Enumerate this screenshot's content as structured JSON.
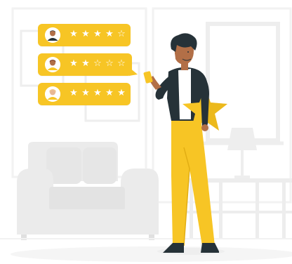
{
  "colors": {
    "accent": "#F7C525",
    "accent_dark": "#E2AE13",
    "background_shapes": "#F2F2F2",
    "background_lines": "#EDEDED",
    "furniture": "#EBEBEB",
    "furniture_shadow": "#E0E0E0",
    "skin": "#B26F47",
    "hair": "#263238",
    "jacket": "#263238",
    "shirt": "#FFFFFF",
    "pants": "#F7C525",
    "shoes": "#263238",
    "star_filled": "#FFFFFF",
    "star_empty": "#FFFFFF"
  },
  "reviews": [
    {
      "rating": 4,
      "max": 5,
      "avatar_icon": "user-avatar-icon"
    },
    {
      "rating": 2,
      "max": 5,
      "avatar_icon": "user-avatar-icon"
    },
    {
      "rating": 5,
      "max": 5,
      "avatar_icon": "user-avatar-icon"
    }
  ],
  "icons": {
    "star_filled": "★",
    "star_empty": "☆"
  }
}
